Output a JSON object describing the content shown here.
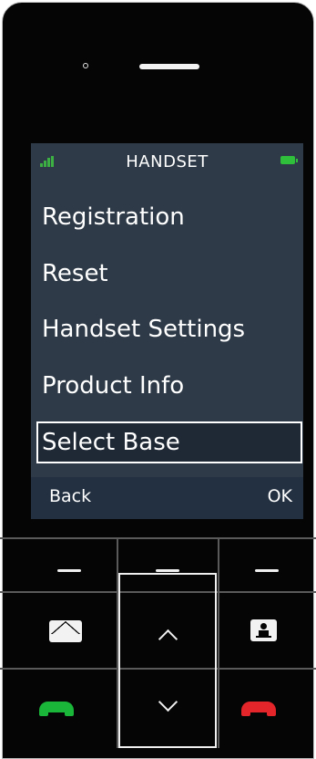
{
  "screen": {
    "title": "HANDSET",
    "icons": {
      "signal": "signal-icon",
      "battery": "battery-icon"
    },
    "menu_items": [
      {
        "label": "Registration",
        "selected": false
      },
      {
        "label": "Reset",
        "selected": false
      },
      {
        "label": "Handset Settings",
        "selected": false
      },
      {
        "label": "Product Info",
        "selected": false
      },
      {
        "label": "Select Base",
        "selected": true
      }
    ],
    "softkeys": {
      "left": "Back",
      "right": "OK"
    }
  },
  "keypad": {
    "icons": [
      "left-softkey-dash",
      "middle-softkey-dash",
      "right-softkey-dash",
      "message-envelope-icon",
      "up-chevron-icon",
      "contacts-icon",
      "call-answer-icon",
      "down-chevron-icon",
      "call-end-icon"
    ]
  },
  "colors": {
    "screen_bg": "#2e3a47",
    "softkey_bar": "#233041",
    "call_green": "#19b63a",
    "call_red": "#e4262b",
    "signal_green": "#3cb043"
  }
}
